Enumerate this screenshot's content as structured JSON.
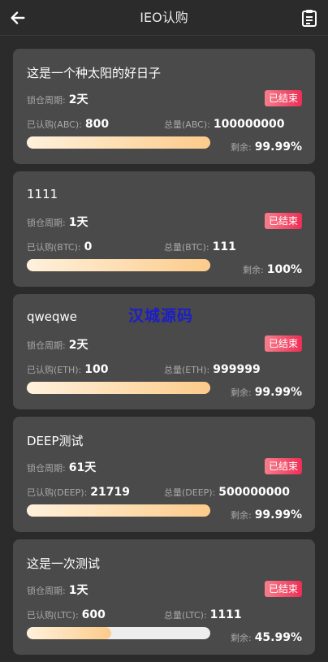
{
  "header": {
    "title": "IEO认购",
    "back_icon": "arrow-left-icon",
    "record_icon": "clipboard-list-icon"
  },
  "labels": {
    "lock_period": "锁仓周期:",
    "subscribed_prefix": "已认购",
    "total_prefix": "总量",
    "remaining": "剩余:",
    "status_ended": "已结束"
  },
  "colors": {
    "background": "#2b2b2b",
    "card": "#4a4a4a",
    "status_gradient_start": "#f77d8b",
    "status_gradient_end": "#ee2e55",
    "progress_start": "#fff1dc",
    "progress_end": "#fccb8a",
    "watermark": "#1c1ec8"
  },
  "watermark": "汉城源码",
  "projects": [
    {
      "name": "这是一个种太阳的好日子",
      "lock_period": "2天",
      "status": "已结束",
      "sold_label": "已认购(ABC):",
      "sold": "800",
      "total_label": "总量(ABC):",
      "total": "100000000",
      "remaining": "99.99%",
      "progress": 1.0
    },
    {
      "name": "1111",
      "lock_period": "1天",
      "status": "已结束",
      "sold_label": "已认购(BTC):",
      "sold": "0",
      "total_label": "总量(BTC):",
      "total": "111",
      "remaining": "100%",
      "progress": 1.0
    },
    {
      "name": "qweqwe",
      "lock_period": "2天",
      "status": "已结束",
      "sold_label": "已认购(ETH):",
      "sold": "100",
      "total_label": "总量(ETH):",
      "total": "999999",
      "remaining": "99.99%",
      "progress": 1.0
    },
    {
      "name": "DEEP测试",
      "lock_period": "61天",
      "status": "已结束",
      "sold_label": "已认购(DEEP):",
      "sold": "21719",
      "total_label": "总量(DEEP):",
      "total": "500000000",
      "remaining": "99.99%",
      "progress": 1.0
    },
    {
      "name": "这是一次测试",
      "lock_period": "1天",
      "status": "已结束",
      "sold_label": "已认购(LTC):",
      "sold": "600",
      "total_label": "总量(LTC):",
      "total": "1111",
      "remaining": "45.99%",
      "progress": 0.46
    }
  ]
}
